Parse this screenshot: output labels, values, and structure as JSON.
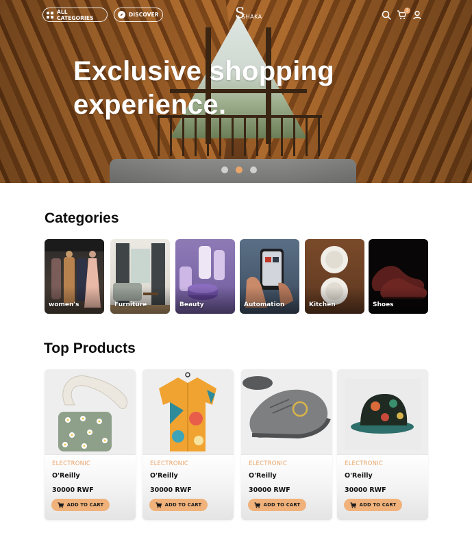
{
  "nav": {
    "categories_label": "ALL CATEGORIES",
    "discover_label": "DISCOVER",
    "logo_mark": "S",
    "logo_text": "SHAKA",
    "cart_count": "3",
    "icons": [
      "grid-icon",
      "compass-icon",
      "search-icon",
      "cart-icon",
      "user-icon"
    ]
  },
  "hero": {
    "title_line1": "Exclusive shopping",
    "title_line2": "experience.",
    "slides": 3,
    "active_slide": 2
  },
  "categories": {
    "title": "Categories",
    "items": [
      {
        "label": "women's"
      },
      {
        "label": "Furniture"
      },
      {
        "label": "Beauty"
      },
      {
        "label": "Automation"
      },
      {
        "label": "Kitchen"
      },
      {
        "label": "Shoes"
      }
    ]
  },
  "products": {
    "title": "Top Products",
    "items": [
      {
        "category": "ELECTRONIC",
        "name": "O'Reilly",
        "price": "30000 RWF",
        "button": "ADD TO CART"
      },
      {
        "category": "ELECTRONIC",
        "name": "O'Reilly",
        "price": "30000 RWF",
        "button": "ADD TO CART"
      },
      {
        "category": "ELECTRONIC",
        "name": "O'Reilly",
        "price": "30000 RWF",
        "button": "ADD TO CART"
      },
      {
        "category": "ELECTRONIC",
        "name": "O'Reilly",
        "price": "30000 RWF",
        "button": "ADD TO CART"
      }
    ]
  },
  "colors": {
    "accent": "#e9a46a",
    "button": "#f0b27a"
  }
}
